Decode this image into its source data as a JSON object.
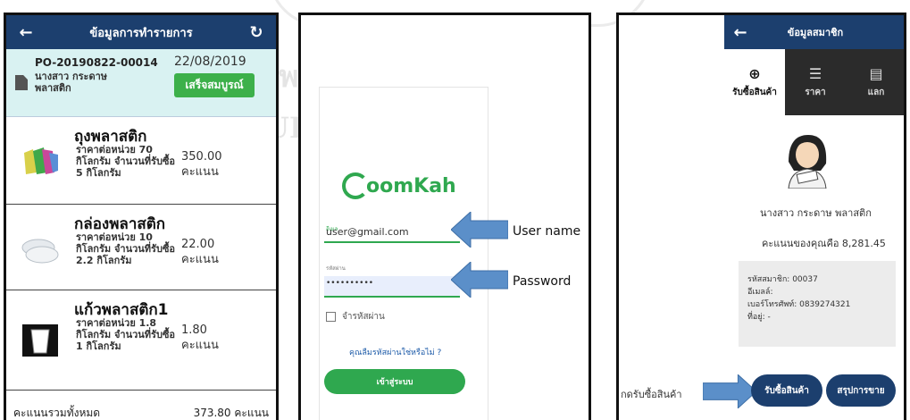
{
  "watermark": {
    "line1": "พ                              ลัย",
    "line2": "UL                              ERSITY"
  },
  "screen1": {
    "header": {
      "back_icon": "arrow-left-icon",
      "title": "ข้อมูลการทำรายการ",
      "refresh_icon": "refresh-icon"
    },
    "summary": {
      "order_id": "PO-20190822-00014",
      "customer": "นางสาว กระดาษ พลาสติก",
      "date": "22/08/2019",
      "status": "เสร็จสมบูรณ์"
    },
    "items": [
      {
        "name": "ถุงพลาสติก",
        "desc": "ราคาต่อหน่วย 70 กิโลกรัม จำนวนที่รับซื้อ 5 กิโลกรัม",
        "points": "350.00",
        "unit": "คะแนน",
        "icon": "plastic-bag-icon"
      },
      {
        "name": "กล่องพลาสติก",
        "desc": "ราคาต่อหน่วย 10 กิโลกรัม จำนวนที่รับซื้อ 2.2 กิโลกรัม",
        "points": "22.00",
        "unit": "คะแนน",
        "icon": "plastic-box-icon"
      },
      {
        "name": "แก้วพลาสติก1",
        "desc": "ราคาต่อหน่วย 1.8 กิโลกรัม จำนวนที่รับซื้อ 1 กิโลกรัม",
        "points": "1.80",
        "unit": "คะแนน",
        "icon": "plastic-cup-icon"
      }
    ],
    "total": {
      "label": "คะแนนรวมทั้งหมด",
      "value": "373.80 คะแนน"
    }
  },
  "screen2": {
    "logo": "oomKah",
    "username": {
      "label": "อีเมล",
      "value": "user@gmail.com"
    },
    "password": {
      "label": "รหัสผ่าน",
      "value": "••••••••••"
    },
    "annotations": {
      "username": "User name",
      "password": "Password"
    },
    "remember": "จำรหัสผ่าน",
    "forgot": "คุณลืมรหัสผ่านใช่หรือไม่ ?",
    "login_button": "เข้าสู่ระบบ"
  },
  "screen3": {
    "header": {
      "back_icon": "arrow-left-icon",
      "title": "ข้อมูลสมาชิก"
    },
    "tabs": [
      {
        "label": "รับซื้อสินค้า",
        "icon": "cart-add-icon",
        "active": true
      },
      {
        "label": "ราคา",
        "icon": "list-icon",
        "active": false
      },
      {
        "label": "แลก",
        "icon": "cart-icon",
        "active": false
      }
    ],
    "member": {
      "name": "นางสาว กระดาษ พลาสติก",
      "points_text": "คะแนนของคุณคือ 8,281.45",
      "member_id": "รหัสสมาชิก: 00037",
      "email": "อีเมลล์:",
      "phone": "เบอร์โทรศัพท์: 0839274321",
      "address": "ที่อยู่: -"
    },
    "annotation": "กดรับซื้อสินค้า",
    "buttons": {
      "buy": "รับซื้อสินค้า",
      "summary": "สรุปการขาย"
    }
  },
  "colors": {
    "header": "#1c3f6e",
    "accent": "#2fa84f",
    "summary_bg": "#d9f2f2",
    "arrow": "#5b8fc9"
  }
}
